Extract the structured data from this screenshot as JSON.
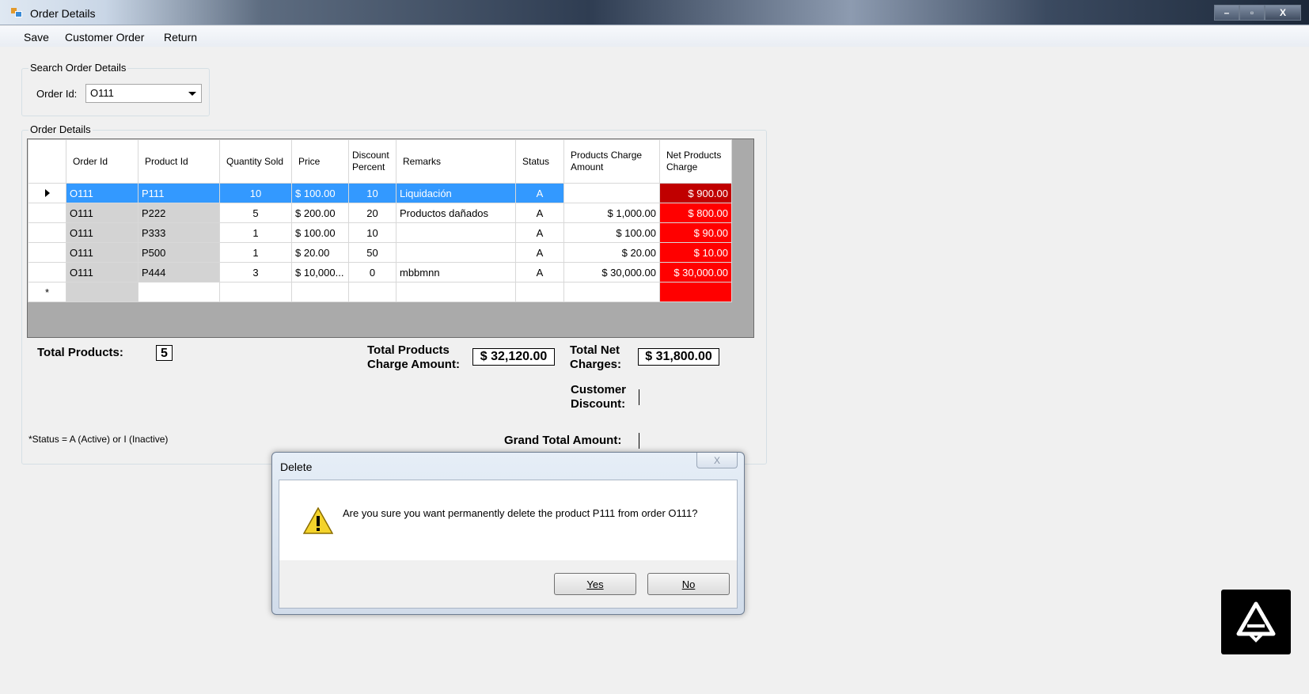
{
  "window": {
    "title": "Order Details",
    "controls": [
      "–",
      "▫",
      "X"
    ]
  },
  "menu": {
    "items": [
      "Save",
      "Customer Order",
      "Return"
    ]
  },
  "search": {
    "group_label": "Search Order Details",
    "order_id_label": "Order Id:",
    "order_id_value": "O111"
  },
  "order_details": {
    "group_label": "Order Details",
    "columns": [
      "Order Id",
      "Product Id",
      "Quantity Sold",
      "Price",
      "Discount Percent",
      "Remarks",
      "Status",
      "Products Charge Amount",
      "Net Products Charge"
    ],
    "rows": [
      {
        "order_id": "O111",
        "product_id": "P111",
        "qty": "10",
        "price": "$ 100.00",
        "discount": "10",
        "remarks": "Liquidación",
        "status": "A",
        "charge": "",
        "net": "$ 900.00"
      },
      {
        "order_id": "O111",
        "product_id": "P222",
        "qty": "5",
        "price": "$ 200.00",
        "discount": "20",
        "remarks": "Productos dañados",
        "status": "A",
        "charge": "$ 1,000.00",
        "net": "$ 800.00"
      },
      {
        "order_id": "O111",
        "product_id": "P333",
        "qty": "1",
        "price": "$ 100.00",
        "discount": "10",
        "remarks": "",
        "status": "A",
        "charge": "$ 100.00",
        "net": "$ 90.00"
      },
      {
        "order_id": "O111",
        "product_id": "P500",
        "qty": "1",
        "price": "$ 20.00",
        "discount": "50",
        "remarks": "",
        "status": "A",
        "charge": "$ 20.00",
        "net": "$ 10.00"
      },
      {
        "order_id": "O111",
        "product_id": "P444",
        "qty": "3",
        "price": "$ 10,000...",
        "discount": "0",
        "remarks": "mbbmnn",
        "status": "A",
        "charge": "$ 30,000.00",
        "net": "$ 30,000.00"
      }
    ],
    "new_row_marker": "*"
  },
  "totals": {
    "total_products_label": "Total Products:",
    "total_products_value": "5",
    "charge_amount_label_1": "Total Products",
    "charge_amount_label_2": "Charge Amount:",
    "charge_amount_value": "$ 32,120.00",
    "net_charges_label_1": "Total Net",
    "net_charges_label_2": "Charges:",
    "net_charges_value": "$ 31,800.00",
    "customer_discount_label_1": "Customer",
    "customer_discount_label_2": "Discount:",
    "grand_total_label": "Grand Total Amount:"
  },
  "note": "*Status = A (Active) or I (Inactive)",
  "dialog": {
    "title": "Delete",
    "close": "X",
    "message": "Are you sure you want permanently delete the product P111 from order O111?",
    "yes_label": "Yes",
    "no_label": "No"
  },
  "colors": {
    "selection": "#3399ff",
    "net_charge": "#ff0000",
    "net_charge_selected": "#c00000"
  }
}
